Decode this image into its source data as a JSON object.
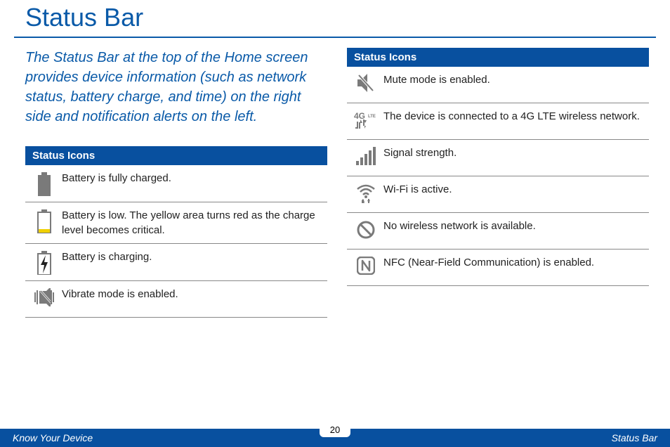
{
  "page": {
    "title": "Status Bar",
    "intro": "The Status Bar at the top of the Home screen provides device information (such as network status, battery charge, and time) on the right side and notification alerts on the left.",
    "footer_left": "Know Your Device",
    "footer_right": "Status Bar",
    "page_number": "20"
  },
  "tables": {
    "left": {
      "header": "Status Icons",
      "rows": [
        {
          "icon": "battery-full-icon",
          "desc": "Battery is fully charged."
        },
        {
          "icon": "battery-low-icon",
          "desc": "Battery is low. The yellow area turns red as the charge level becomes critical."
        },
        {
          "icon": "battery-charging-icon",
          "desc": "Battery is charging."
        },
        {
          "icon": "vibrate-icon",
          "desc": "Vibrate mode is enabled."
        }
      ]
    },
    "right": {
      "header": "Status Icons",
      "rows": [
        {
          "icon": "mute-icon",
          "desc": "Mute mode is enabled."
        },
        {
          "icon": "4g-lte-icon",
          "desc": "The device is connected to a 4G LTE wireless network."
        },
        {
          "icon": "signal-strength-icon",
          "desc": "Signal strength."
        },
        {
          "icon": "wifi-icon",
          "desc": "Wi-Fi is active."
        },
        {
          "icon": "no-network-icon",
          "desc": "No wireless network is available."
        },
        {
          "icon": "nfc-icon",
          "desc": "NFC (Near-Field Communication) is enabled."
        }
      ]
    }
  }
}
